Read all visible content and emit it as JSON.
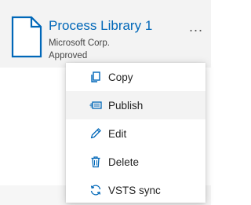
{
  "library_card": {
    "title": "Process Library 1",
    "publisher": "Microsoft Corp.",
    "status": "Approved",
    "more_label": "..."
  },
  "context_menu": {
    "items": [
      {
        "label": "Copy",
        "icon": "copy-icon",
        "highlighted": false
      },
      {
        "label": "Publish",
        "icon": "publish-icon",
        "highlighted": true
      },
      {
        "label": "Edit",
        "icon": "edit-icon",
        "highlighted": false
      },
      {
        "label": "Delete",
        "icon": "delete-icon",
        "highlighted": false
      },
      {
        "label": "VSTS sync",
        "icon": "sync-icon",
        "highlighted": false
      }
    ]
  },
  "colors": {
    "title": "#0067b8",
    "icon": "#0067b8",
    "card_background": "#f3f3f3",
    "highlight": "#f3f3f3"
  }
}
